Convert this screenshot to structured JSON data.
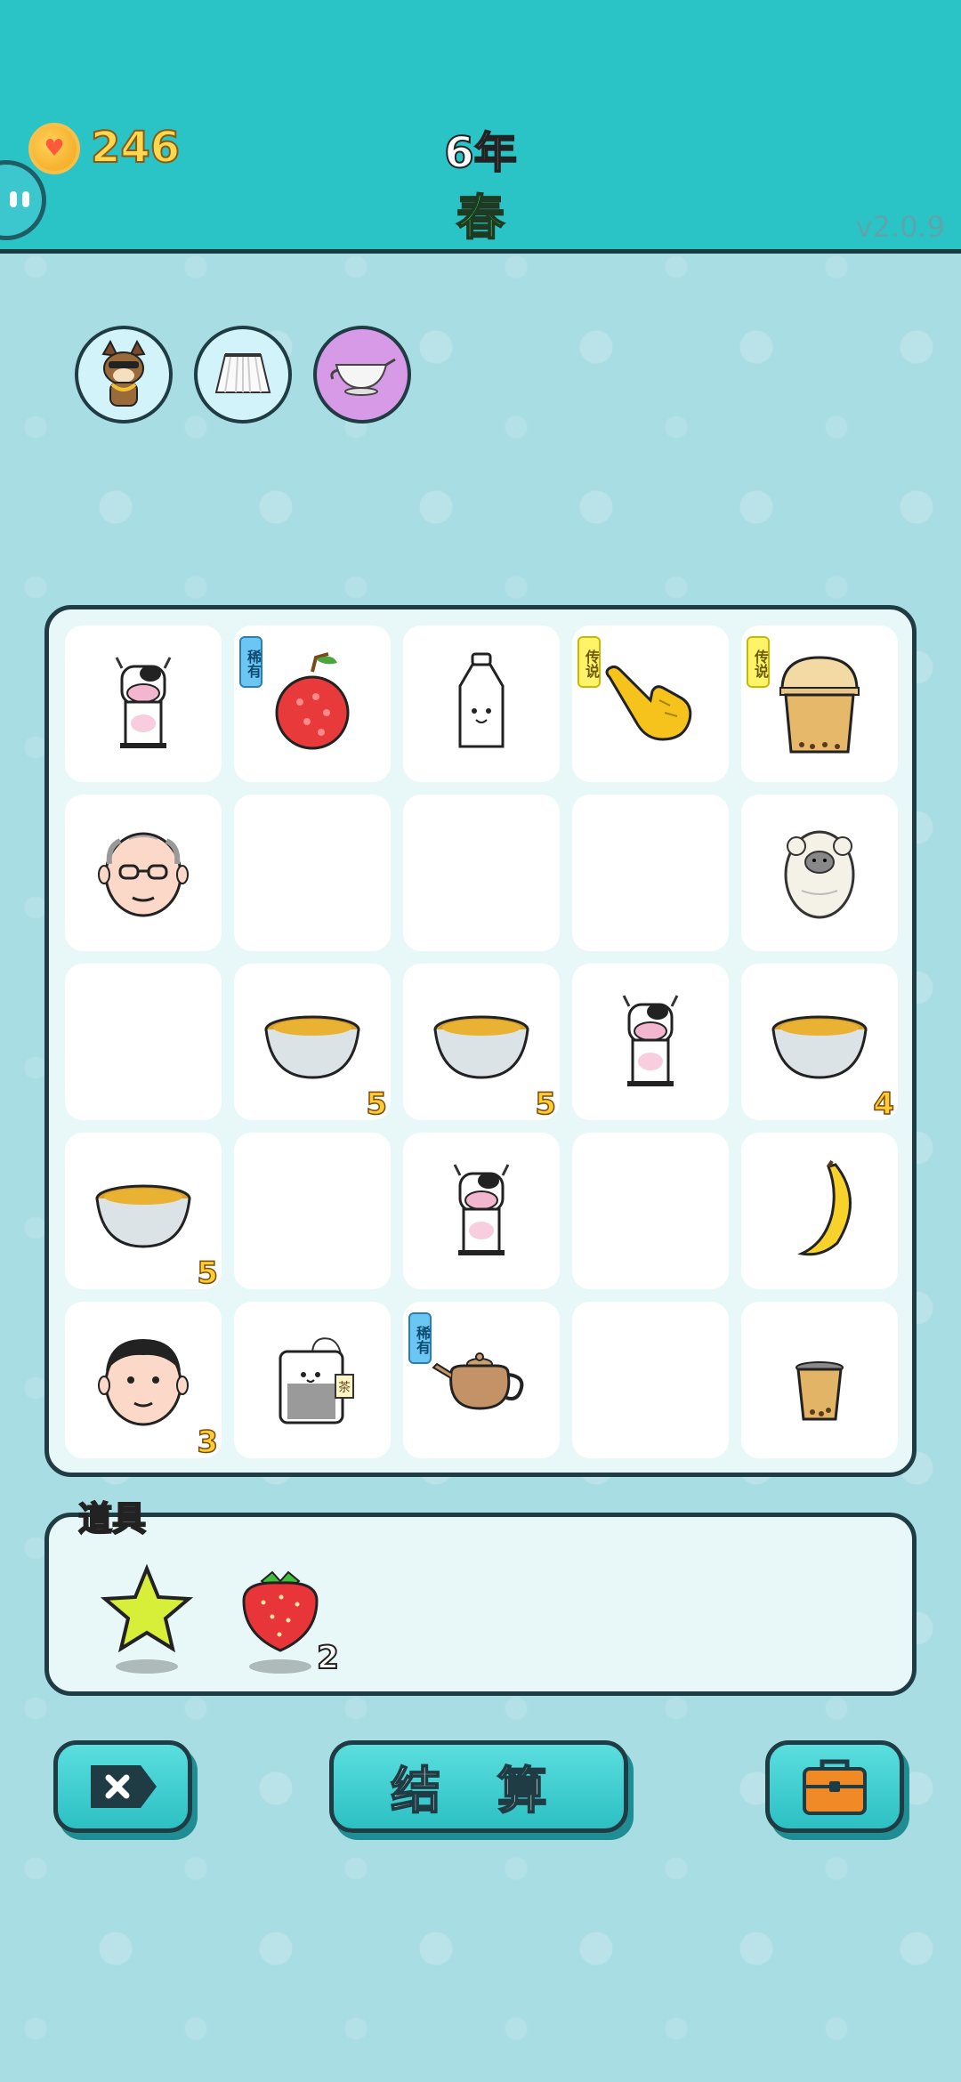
{
  "header": {
    "coins": "246",
    "year": "6年",
    "season": "春",
    "version": "v2.0.9"
  },
  "equipped": [
    {
      "name": "dog-with-sunglasses-icon",
      "color": "#d2f3fa"
    },
    {
      "name": "white-skirt-icon",
      "color": "#d2f3fa"
    },
    {
      "name": "gravy-boat-icon",
      "color": "#d69ae6"
    }
  ],
  "board": {
    "rows": [
      [
        {
          "item": "cow-icon"
        },
        {
          "item": "lychee-icon",
          "tag": "稀有"
        },
        {
          "item": "milk-bottle-icon"
        },
        {
          "item": "pointing-hand-icon",
          "tag": "传说"
        },
        {
          "item": "bubble-tea-cup-icon",
          "tag": "传说"
        }
      ],
      [
        {
          "item": "old-man-face-icon"
        },
        {
          "item": ""
        },
        {
          "item": ""
        },
        {
          "item": ""
        },
        {
          "item": "sheep-icon"
        }
      ],
      [
        {
          "item": ""
        },
        {
          "item": "tea-bowl-icon",
          "count": "5"
        },
        {
          "item": "tea-bowl-icon",
          "count": "5"
        },
        {
          "item": "cow-icon"
        },
        {
          "item": "tea-bowl-icon",
          "count": "4"
        }
      ],
      [
        {
          "item": "tea-bowl-icon",
          "count": "5"
        },
        {
          "item": ""
        },
        {
          "item": "cow-icon"
        },
        {
          "item": ""
        },
        {
          "item": "banana-icon"
        }
      ],
      [
        {
          "item": "man-face-icon",
          "count": "3"
        },
        {
          "item": "tea-bag-icon",
          "label": "茶"
        },
        {
          "item": "teapot-icon",
          "tag": "稀有"
        },
        {
          "item": ""
        },
        {
          "item": "small-bubble-tea-icon"
        }
      ]
    ]
  },
  "items": {
    "label": "道具",
    "list": [
      {
        "item": "star-icon",
        "count": ""
      },
      {
        "item": "strawberry-icon",
        "count": "2"
      }
    ]
  },
  "buttons": {
    "settle_label": "结 算"
  }
}
